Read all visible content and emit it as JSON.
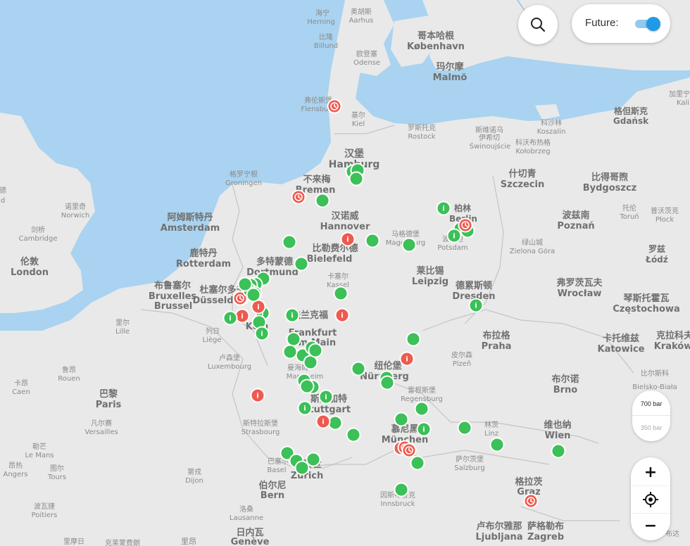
{
  "controls": {
    "future_label": "Future:",
    "future_enabled": true,
    "pressure_options": [
      "700 bar",
      "350 bar"
    ],
    "pressure_selected": "700 bar",
    "zoom_in": "+",
    "zoom_out": "−",
    "accent_color": "#1e9be6"
  },
  "map": {
    "water_color": "#a9d3f0",
    "land_color": "#e9e9e9",
    "station_open_color": "#3cc058",
    "station_closed_color": "#ef5a4e",
    "labels": [
      {
        "id": "l1",
        "t": "海宁"
      },
      {
        "id": "l2",
        "t": "Herning"
      },
      {
        "id": "l3",
        "t": "奥胡斯"
      },
      {
        "id": "l4",
        "t": "Aarhus"
      },
      {
        "id": "l5",
        "t": "比隆"
      },
      {
        "id": "l6",
        "t": "Billund"
      },
      {
        "id": "l7",
        "t": "欧登塞"
      },
      {
        "id": "l8",
        "t": "Odense"
      },
      {
        "id": "l9",
        "t": "哥本哈根"
      },
      {
        "id": "l10",
        "t": "København"
      },
      {
        "id": "l11",
        "t": "玛尔摩"
      },
      {
        "id": "l12",
        "t": "Malmö"
      },
      {
        "id": "l13",
        "t": "弗伦斯堡"
      },
      {
        "id": "l14",
        "t": "Flensburg"
      },
      {
        "id": "l15",
        "t": "基尔"
      },
      {
        "id": "l16",
        "t": "Kiel"
      },
      {
        "id": "l17",
        "t": "罗斯托克"
      },
      {
        "id": "l18",
        "t": "Rostock"
      },
      {
        "id": "l19",
        "t": "斯维诺乌"
      },
      {
        "id": "l20",
        "t": "伊希切"
      },
      {
        "id": "l21",
        "t": "Świnoujście"
      },
      {
        "id": "l22",
        "t": "科沙林"
      },
      {
        "id": "l23",
        "t": "Koszalin"
      },
      {
        "id": "l24",
        "t": "科沃布热格"
      },
      {
        "id": "l25",
        "t": "Kołobrzeg"
      },
      {
        "id": "l26",
        "t": "格但斯克"
      },
      {
        "id": "l27",
        "t": "Gdańsk"
      },
      {
        "id": "l28",
        "t": "加里宁"
      },
      {
        "id": "l29",
        "t": "Kali"
      },
      {
        "id": "l30",
        "t": "汉堡"
      },
      {
        "id": "l31",
        "t": "Hamburg"
      },
      {
        "id": "l32",
        "t": "格罗宁根"
      },
      {
        "id": "l33",
        "t": "Groningen"
      },
      {
        "id": "l34",
        "t": "不来梅"
      },
      {
        "id": "l35",
        "t": "Bremen"
      },
      {
        "id": "l36",
        "t": "什切青"
      },
      {
        "id": "l37",
        "t": "Szczecin"
      },
      {
        "id": "l38",
        "t": "比得哥煦"
      },
      {
        "id": "l39",
        "t": "Bydgoszcz"
      },
      {
        "id": "l40",
        "t": "诺里奇"
      },
      {
        "id": "l41",
        "t": "Norwich"
      },
      {
        "id": "l42",
        "t": "阿姆斯特丹"
      },
      {
        "id": "l43",
        "t": "Amsterdam"
      },
      {
        "id": "l44",
        "t": "柏林"
      },
      {
        "id": "l45",
        "t": "Berlin"
      },
      {
        "id": "l46",
        "t": "汉诺威"
      },
      {
        "id": "l47",
        "t": "Hannover"
      },
      {
        "id": "l48",
        "t": "托伦"
      },
      {
        "id": "l49",
        "t": "Toruń"
      },
      {
        "id": "l50",
        "t": "普沃茨克"
      },
      {
        "id": "l51",
        "t": "Płock"
      },
      {
        "id": "l52",
        "t": "剑桥"
      },
      {
        "id": "l53",
        "t": "Cambridge"
      },
      {
        "id": "l54",
        "t": "马格德堡"
      },
      {
        "id": "l55",
        "t": "Magdeburg"
      },
      {
        "id": "l56",
        "t": "波兹南"
      },
      {
        "id": "l57",
        "t": "Poznań"
      },
      {
        "id": "l58",
        "t": "波茨坦"
      },
      {
        "id": "l59",
        "t": "Potsdam"
      },
      {
        "id": "l60",
        "t": "绿山城"
      },
      {
        "id": "l61",
        "t": "Zielona Góra"
      },
      {
        "id": "l62",
        "t": "鹿特丹"
      },
      {
        "id": "l63",
        "t": "Rotterdam"
      },
      {
        "id": "l64",
        "t": "比勒费尔德"
      },
      {
        "id": "l65",
        "t": "Bielefeld"
      },
      {
        "id": "l66",
        "t": "伦敦"
      },
      {
        "id": "l67",
        "t": "London"
      },
      {
        "id": "l68",
        "t": "多特蒙德"
      },
      {
        "id": "l69",
        "t": "Dortmund"
      },
      {
        "id": "l70",
        "t": "莱比锡"
      },
      {
        "id": "l71",
        "t": "Leipzig"
      },
      {
        "id": "l72",
        "t": "罗兹"
      },
      {
        "id": "l73",
        "t": "Łódź"
      },
      {
        "id": "l74",
        "t": "卡塞尔"
      },
      {
        "id": "l75",
        "t": "Kassel"
      },
      {
        "id": "l76",
        "t": "布鲁塞尔"
      },
      {
        "id": "l77",
        "t": "Bruxelles"
      },
      {
        "id": "l78",
        "t": "Brussel"
      },
      {
        "id": "l79",
        "t": "杜塞尔多夫"
      },
      {
        "id": "l80",
        "t": "Düsseldorf"
      },
      {
        "id": "l81",
        "t": "德累斯顿"
      },
      {
        "id": "l82",
        "t": "Dresden"
      },
      {
        "id": "l83",
        "t": "弗罗茨瓦夫"
      },
      {
        "id": "l84",
        "t": "Wrocław"
      },
      {
        "id": "l85",
        "t": "琴斯托霍瓦"
      },
      {
        "id": "l86",
        "t": "Częstochowa"
      },
      {
        "id": "l87",
        "t": "法兰克福"
      },
      {
        "id": "l88",
        "t": "Frankfurt"
      },
      {
        "id": "l89",
        "t": "am Main"
      },
      {
        "id": "l90",
        "t": "Köln"
      },
      {
        "id": "l91",
        "t": "里尔"
      },
      {
        "id": "l92",
        "t": "Lille"
      },
      {
        "id": "l93",
        "t": "列日"
      },
      {
        "id": "l94",
        "t": "Liège"
      },
      {
        "id": "l95",
        "t": "布拉格"
      },
      {
        "id": "l96",
        "t": "Praha"
      },
      {
        "id": "l97",
        "t": "卡托维兹"
      },
      {
        "id": "l98",
        "t": "Katowice"
      },
      {
        "id": "l99",
        "t": "克拉科夫"
      },
      {
        "id": "l100",
        "t": "Kraków"
      },
      {
        "id": "l101",
        "t": "卢森堡"
      },
      {
        "id": "l102",
        "t": "Luxembourg"
      },
      {
        "id": "l103",
        "t": "皮尔森"
      },
      {
        "id": "l104",
        "t": "Plzeň"
      },
      {
        "id": "l105",
        "t": "纽伦堡"
      },
      {
        "id": "l106",
        "t": "Nürnberg"
      },
      {
        "id": "l107",
        "t": "鲁昂"
      },
      {
        "id": "l108",
        "t": "Rouen"
      },
      {
        "id": "l109",
        "t": "曼海姆"
      },
      {
        "id": "l110",
        "t": "Mannheim"
      },
      {
        "id": "l111",
        "t": "布尔诺"
      },
      {
        "id": "l112",
        "t": "Brno"
      },
      {
        "id": "l113",
        "t": "比尔斯科"
      },
      {
        "id": "l114",
        "t": "Bielsko-Biała"
      },
      {
        "id": "l115",
        "t": "卡昂"
      },
      {
        "id": "l116",
        "t": "Caen"
      },
      {
        "id": "l117",
        "t": "巴黎"
      },
      {
        "id": "l118",
        "t": "Paris"
      },
      {
        "id": "l119",
        "t": "雷根斯堡"
      },
      {
        "id": "l120",
        "t": "Regensburg"
      },
      {
        "id": "l121",
        "t": "斯图加特"
      },
      {
        "id": "l122",
        "t": "Stuttgart"
      },
      {
        "id": "l123",
        "t": "凡尔赛"
      },
      {
        "id": "l124",
        "t": "Versailles"
      },
      {
        "id": "l125",
        "t": "斯特拉斯堡"
      },
      {
        "id": "l126",
        "t": "Strasbourg"
      },
      {
        "id": "l127",
        "t": "林茨"
      },
      {
        "id": "l128",
        "t": "Linz"
      },
      {
        "id": "l129",
        "t": "慕尼黑"
      },
      {
        "id": "l130",
        "t": "München"
      },
      {
        "id": "l131",
        "t": "维也纳"
      },
      {
        "id": "l132",
        "t": "Wien"
      },
      {
        "id": "l133",
        "t": "勒芒"
      },
      {
        "id": "l134",
        "t": "Le Mans"
      },
      {
        "id": "l135",
        "t": "萨尔茨堡"
      },
      {
        "id": "l136",
        "t": "Salzburg"
      },
      {
        "id": "l137",
        "t": "昂热"
      },
      {
        "id": "l138",
        "t": "Angers"
      },
      {
        "id": "l139",
        "t": "图尔"
      },
      {
        "id": "l140",
        "t": "Tours"
      },
      {
        "id": "l141",
        "t": "第戎"
      },
      {
        "id": "l142",
        "t": "Dijon"
      },
      {
        "id": "l143",
        "t": "巴塞尔"
      },
      {
        "id": "l144",
        "t": "Basel"
      },
      {
        "id": "l145",
        "t": "苏黎世"
      },
      {
        "id": "l146",
        "t": "Zürich"
      },
      {
        "id": "l147",
        "t": "伯尔尼"
      },
      {
        "id": "l148",
        "t": "Bern"
      },
      {
        "id": "l149",
        "t": "格拉茨"
      },
      {
        "id": "l150",
        "t": "Graz"
      },
      {
        "id": "l151",
        "t": "波瓦捷"
      },
      {
        "id": "l152",
        "t": "Poitiers"
      },
      {
        "id": "l153",
        "t": "因斯布鲁克"
      },
      {
        "id": "l154",
        "t": "Innsbruck"
      },
      {
        "id": "l155",
        "t": "洛桑"
      },
      {
        "id": "l156",
        "t": "Lausanne"
      },
      {
        "id": "l157",
        "t": "卢布尔雅那"
      },
      {
        "id": "l158",
        "t": "Ljubljana"
      },
      {
        "id": "l159",
        "t": "萨格勒布"
      },
      {
        "id": "l160",
        "t": "Zagreb"
      },
      {
        "id": "l161",
        "t": "日内瓦"
      },
      {
        "id": "l162",
        "t": "Genève"
      },
      {
        "id": "l163",
        "t": "里摩日"
      },
      {
        "id": "l164",
        "t": "克莱蒙费朗"
      },
      {
        "id": "l165",
        "t": "里昂"
      },
      {
        "id": "l166",
        "t": "布达"
      },
      {
        "id": "l167",
        "t": "德"
      },
      {
        "id": "l168",
        "t": "d"
      }
    ],
    "stations": [
      {
        "s": "green",
        "icon": "none"
      },
      {
        "s": "green",
        "icon": "none"
      },
      {
        "s": "green",
        "icon": "none"
      },
      {
        "s": "green",
        "icon": "none"
      },
      {
        "s": "green",
        "icon": "info"
      },
      {
        "s": "green",
        "icon": "none"
      },
      {
        "s": "green",
        "icon": "none"
      },
      {
        "s": "green",
        "icon": "info"
      },
      {
        "s": "red",
        "icon": "clock"
      },
      {
        "s": "red",
        "icon": "clock"
      },
      {
        "s": "red",
        "icon": "info"
      },
      {
        "s": "red",
        "icon": "clock"
      },
      {
        "s": "red",
        "icon": "info"
      },
      {
        "s": "green",
        "icon": "none"
      },
      {
        "s": "green",
        "icon": "none"
      },
      {
        "s": "green",
        "icon": "none"
      },
      {
        "s": "green",
        "icon": "none"
      },
      {
        "s": "green",
        "icon": "none"
      },
      {
        "s": "green",
        "icon": "none"
      },
      {
        "s": "green",
        "icon": "none"
      },
      {
        "s": "green",
        "icon": "info"
      },
      {
        "s": "green",
        "icon": "none"
      },
      {
        "s": "red",
        "icon": "clock"
      },
      {
        "s": "red",
        "icon": "info"
      },
      {
        "s": "red",
        "icon": "info"
      },
      {
        "s": "green",
        "icon": "info"
      },
      {
        "s": "green",
        "icon": "none"
      },
      {
        "s": "green",
        "icon": "info"
      },
      {
        "s": "green",
        "icon": "info"
      },
      {
        "s": "green",
        "icon": "none"
      },
      {
        "s": "red",
        "icon": "info"
      },
      {
        "s": "green",
        "icon": "none"
      },
      {
        "s": "green",
        "icon": "none"
      },
      {
        "s": "green",
        "icon": "info"
      },
      {
        "s": "green",
        "icon": "none"
      },
      {
        "s": "green",
        "icon": "none"
      },
      {
        "s": "green",
        "icon": "none"
      },
      {
        "s": "green",
        "icon": "none"
      },
      {
        "s": "green",
        "icon": "none"
      },
      {
        "s": "green",
        "icon": "info"
      },
      {
        "s": "green",
        "icon": "info"
      },
      {
        "s": "green",
        "icon": "none"
      },
      {
        "s": "green",
        "icon": "none"
      },
      {
        "s": "green",
        "icon": "none"
      },
      {
        "s": "red",
        "icon": "info"
      },
      {
        "s": "green",
        "icon": "none"
      },
      {
        "s": "green",
        "icon": "none"
      },
      {
        "s": "green",
        "icon": "none"
      },
      {
        "s": "red",
        "icon": "info"
      },
      {
        "s": "green",
        "icon": "none"
      },
      {
        "s": "red",
        "icon": "info"
      },
      {
        "s": "green",
        "icon": "info"
      },
      {
        "s": "green",
        "icon": "none"
      },
      {
        "s": "red",
        "icon": "info"
      },
      {
        "s": "green",
        "icon": "none"
      },
      {
        "s": "green",
        "icon": "none"
      },
      {
        "s": "green",
        "icon": "none"
      },
      {
        "s": "green",
        "icon": "none"
      },
      {
        "s": "green",
        "icon": "none"
      },
      {
        "s": "green",
        "icon": "none"
      },
      {
        "s": "green",
        "icon": "none"
      },
      {
        "s": "green",
        "icon": "none"
      },
      {
        "s": "red",
        "icon": "clock"
      },
      {
        "s": "red",
        "icon": "clock"
      },
      {
        "s": "green",
        "icon": "none"
      },
      {
        "s": "green",
        "icon": "none"
      },
      {
        "s": "green",
        "icon": "none"
      },
      {
        "s": "green",
        "icon": "none"
      },
      {
        "s": "green",
        "icon": "info"
      },
      {
        "s": "green",
        "icon": "none"
      },
      {
        "s": "red",
        "icon": "clock"
      }
    ]
  }
}
